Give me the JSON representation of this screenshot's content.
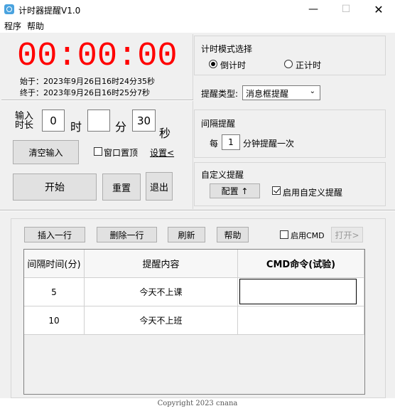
{
  "window": {
    "title": "计时器提醒V1.0",
    "min_glyph": "—",
    "max_glyph": "☐",
    "close_glyph": "✕"
  },
  "menu": [
    "程序",
    "帮助"
  ],
  "timer": {
    "display": "00:00:00",
    "start_label": "始于：2023年9月26日16时24分35秒",
    "end_label": "终于：2023年9月26日16时25分7秒",
    "color": "#ff0000"
  },
  "duration": {
    "label": "输入时长",
    "hours": "0",
    "hours_unit": "时",
    "minutes": "",
    "minutes_unit": "分",
    "seconds": "30",
    "seconds_unit": "秒"
  },
  "actions": {
    "clear": "清空输入",
    "pin_window": "窗口置顶",
    "settings": "设置<",
    "start": "开始",
    "reset": "重置",
    "exit": "退出"
  },
  "mode": {
    "title": "计时模式选择",
    "countdown": "倒计时",
    "countup": "正计时",
    "selected": "countdown"
  },
  "reminder_type": {
    "label": "提醒类型:",
    "value": "消息框提醒"
  },
  "interval": {
    "title": "间隔提醒",
    "prefix": "每",
    "value": "1",
    "suffix": "分钟提醒一次"
  },
  "custom": {
    "title": "自定义提醒",
    "config": "配置 ↑",
    "enable_label": "启用自定义提醒",
    "enabled": true
  },
  "table_toolbar": {
    "insert": "插入一行",
    "delete": "删除一行",
    "refresh": "刷新",
    "help": "帮助",
    "enable_cmd": "启用CMD",
    "open": "打开>"
  },
  "table": {
    "headers": [
      "间隔时间(分)",
      "提醒内容",
      "CMD命令(试验)"
    ],
    "rows": [
      [
        "5",
        "今天不上课",
        ""
      ],
      [
        "10",
        "今天不上班",
        ""
      ]
    ]
  },
  "footer": "Copyright 2023 cnana"
}
